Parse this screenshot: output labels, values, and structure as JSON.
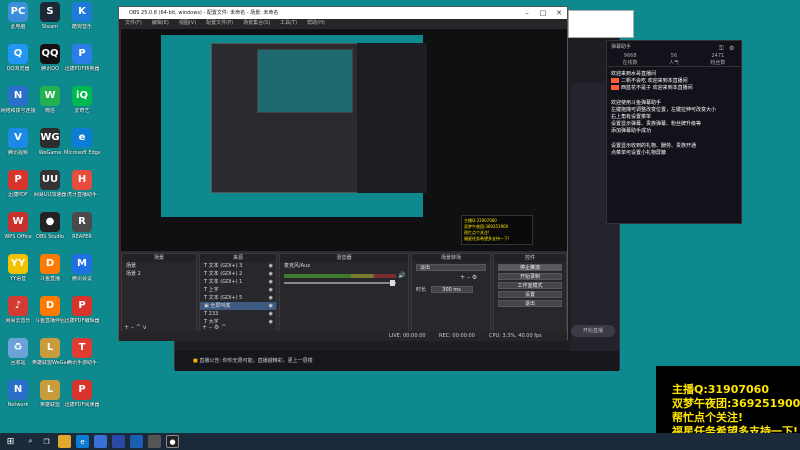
{
  "desktop_icons": [
    {
      "label": "此电脑",
      "color": "#3a8fd8",
      "glyph": "PC",
      "icon": "computer-icon"
    },
    {
      "label": "Steam",
      "color": "#1b2838",
      "glyph": "S",
      "icon": "steam-icon"
    },
    {
      "label": "酷狗音乐",
      "color": "#1e7ad8",
      "glyph": "K",
      "icon": "kugou-icon"
    },
    {
      "label": "QQ浏览器",
      "color": "#2196f3",
      "glyph": "Q",
      "icon": "qq-browser-icon"
    },
    {
      "label": "腾讯QQ",
      "color": "#111",
      "glyph": "QQ",
      "icon": "qq-icon"
    },
    {
      "label": "迅捷PDF转换器",
      "color": "#2b7de9",
      "glyph": "P",
      "icon": "pdf-converter-icon"
    },
    {
      "label": "网络和拨号连接",
      "color": "#2a6fc9",
      "glyph": "N",
      "icon": "network-connections-icon"
    },
    {
      "label": "微信",
      "color": "#22b14c",
      "glyph": "W",
      "icon": "wechat-icon"
    },
    {
      "label": "爱奇艺",
      "color": "#00b84f",
      "glyph": "iQ",
      "icon": "iqiyi-icon"
    },
    {
      "label": "腾讯视频",
      "color": "#1e88e5",
      "glyph": "V",
      "icon": "tencent-video-icon"
    },
    {
      "label": "WeGame",
      "color": "#2d2d2d",
      "glyph": "WG",
      "icon": "wegame-icon"
    },
    {
      "label": "Microsoft Edge",
      "color": "#0c7cd5",
      "glyph": "e",
      "icon": "edge-icon"
    },
    {
      "label": "迅捷PDF",
      "color": "#d9342b",
      "glyph": "P",
      "icon": "pdf-icon"
    },
    {
      "label": "网易UU加速器",
      "color": "#333",
      "glyph": "UU",
      "icon": "uu-accelerator-icon"
    },
    {
      "label": "虎牙直播助手",
      "color": "#e74c3c",
      "glyph": "H",
      "icon": "huya-icon"
    },
    {
      "label": "WPS Office",
      "color": "#c9302c",
      "glyph": "W",
      "icon": "wps-icon"
    },
    {
      "label": "OBS Studio",
      "color": "#222",
      "glyph": "●",
      "icon": "obs-icon"
    },
    {
      "label": "REAPER",
      "color": "#4a4a4a",
      "glyph": "R",
      "icon": "reaper-icon"
    },
    {
      "label": "YY语音",
      "color": "#f2c200",
      "glyph": "YY",
      "icon": "yy-icon"
    },
    {
      "label": "斗鱼直播",
      "color": "#ff7a00",
      "glyph": "D",
      "icon": "douyu-icon"
    },
    {
      "label": "腾讯会议",
      "color": "#1f6fe5",
      "glyph": "M",
      "icon": "tencent-meeting-icon"
    },
    {
      "label": "网易云音乐",
      "color": "#d33a31",
      "glyph": "♪",
      "icon": "netease-music-icon"
    },
    {
      "label": "斗鱼直播伴侣",
      "color": "#ff7a00",
      "glyph": "D",
      "icon": "douyu-companion-icon"
    },
    {
      "label": "迅捷PDF编辑器",
      "color": "#d9342b",
      "glyph": "P",
      "icon": "pdf-editor-icon"
    },
    {
      "label": "回收站",
      "color": "#6ba3d8",
      "glyph": "♻",
      "icon": "recycle-bin-icon"
    },
    {
      "label": "英雄联盟WeGame版",
      "color": "#c89b3c",
      "glyph": "L",
      "icon": "lol-wegame-icon"
    },
    {
      "label": "腾讯手游助手",
      "color": "#e03c31",
      "glyph": "T",
      "icon": "tencent-mobile-game-icon"
    },
    {
      "label": "Network",
      "color": "#2a6fc9",
      "glyph": "N",
      "icon": "network-icon"
    },
    {
      "label": "英雄联盟",
      "color": "#c89b3c",
      "glyph": "L",
      "icon": "lol-icon"
    },
    {
      "label": "迅捷PDF阅读器",
      "color": "#d9342b",
      "glyph": "P",
      "icon": "pdf-reader-icon"
    }
  ],
  "obs": {
    "title": "OBS 25.0.8 (64-bit, windows) - 配置文件: 未命名 - 场景: 未命名",
    "menu": [
      "文件(F)",
      "编辑(E)",
      "视图(V)",
      "配置文件(P)",
      "场景集合(S)",
      "工具(T)",
      "帮助(H)"
    ],
    "docks": {
      "scenes": {
        "title": "场景",
        "items": [
          "场景",
          "场景 2"
        ]
      },
      "sources": {
        "title": "来源",
        "items": [
          "文本 (GDI+) 3",
          "文本 (GDI+) 2",
          "文本 (GDI+) 1",
          "上字",
          "文本 (GDI+) 5",
          "全屏叫底",
          "233",
          "大字"
        ]
      },
      "mixer": {
        "title": "混音器",
        "track": "麦克风/Aux"
      },
      "transitions": {
        "title": "场景转场",
        "type": "淡出",
        "duration_label": "时长",
        "duration": "300 ms"
      },
      "controls": {
        "title": "控件",
        "buttons": [
          "停止推流",
          "开始录制",
          "工作室模式",
          "设置",
          "退出"
        ]
      }
    },
    "status": {
      "live": "LIVE: 00:00:00",
      "rec": "REC: 00:00:00",
      "cpu": "CPU: 3.3%, 40.00 fps"
    }
  },
  "bg_window": {
    "notice": "直播公告: 你你无限可能，直播越精彩，更上一层楼",
    "buttons": [
      "开始直播"
    ]
  },
  "assistant": {
    "title": "弹幕助手",
    "stats": [
      {
        "value": "9668",
        "label": "在线数"
      },
      {
        "value": "56",
        "label": "人气"
      },
      {
        "value": "2471",
        "label": "粉丝数"
      }
    ],
    "messages": [
      "欢迎来到水哥直播间",
      "二帆不会吃  欢迎来到本直播间",
      "西蓝花不是子  欢迎来到本直播间",
      "欢迎使用斗鱼弹幕助手",
      "左键拖拽可调整改变位置，左键拉伸可改变大小",
      "右上角有设置菜单",
      "设置显示弹幕、贵族弹幕、粉丝牌升级等",
      "添加弹幕助手成功",
      "设置显示收到的礼物、酬劳、贵族开通",
      "点菜单可设置小礼物屏蔽"
    ]
  },
  "preview_overlay": {
    "lines": [
      "主播Q:31907060",
      "双梦午夜团:369251900",
      "帮忙点个关注!",
      "福星任务希望多支持一下!"
    ]
  },
  "overlay": {
    "lines": [
      "主播Q:31907060",
      "双梦午夜团:369251900",
      "帮忙点个关注!",
      "福星任务希望多支持一下!"
    ],
    "color": "#ffe600"
  }
}
